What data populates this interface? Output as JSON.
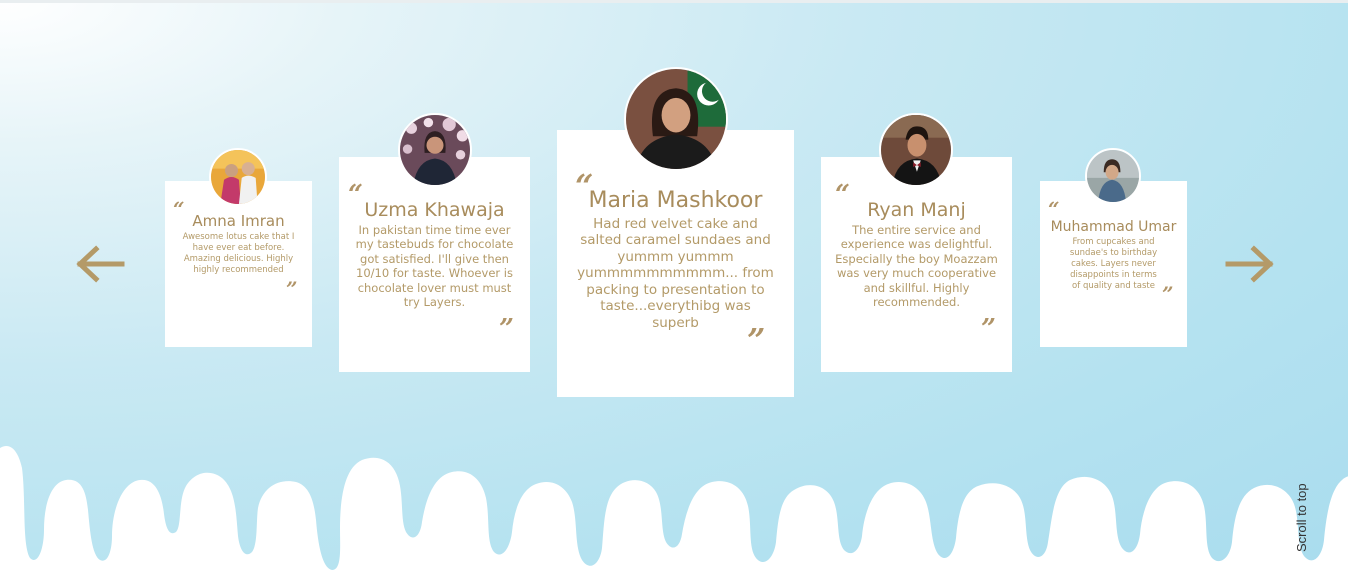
{
  "section": {
    "scroll_to_top": "Scroll to top",
    "prev_icon": "arrow-left-icon",
    "next_icon": "arrow-right-icon"
  },
  "testimonials": [
    {
      "name": "Amna Imran",
      "quote": "Awesome lotus cake that I have ever eat before. Amazing delicious. Highly highly recommended"
    },
    {
      "name": "Uzma Khawaja",
      "quote": "In pakistan time time ever my tastebuds for chocolate got satisfied. I'll give then 10/10 for taste. Whoever is chocolate lover must must try Layers."
    },
    {
      "name": "Maria Mashkoor",
      "quote": "Had red velvet cake and salted caramel sundaes and yummm yummm yummmmmmmmmm... from packing to presentation to taste...everythibg was superb"
    },
    {
      "name": "Ryan Manj",
      "quote": "The entire service and experience was delightful. Especially the boy Moazzam was very much cooperative and skillful. Highly recommended."
    },
    {
      "name": "Muhammad Umar",
      "quote": "From cupcakes and sundae's to birthday cakes. Layers never disappoints in terms of quality and taste"
    }
  ],
  "colors": {
    "accent": "#b59b69",
    "background": "#b4e2f0",
    "card": "#ffffff"
  }
}
